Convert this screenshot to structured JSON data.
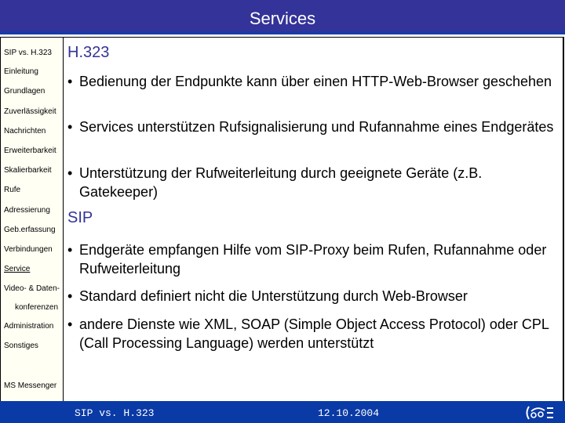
{
  "header": {
    "title": "Services"
  },
  "sidebar": {
    "items": [
      {
        "label": "SIP vs. H.323"
      },
      {
        "label": "Einleitung"
      },
      {
        "label": "Grundlagen"
      },
      {
        "label": "Zuverlässigkeit"
      },
      {
        "label": "Nachrichten"
      },
      {
        "label": "Erweiterbarkeit"
      },
      {
        "label": "Skalierbarkeit"
      },
      {
        "label": "Rufe"
      },
      {
        "label": "Adressierung"
      },
      {
        "label": "Geb.erfassung"
      },
      {
        "label": "Verbindungen"
      },
      {
        "label": "Service",
        "active": true
      },
      {
        "label": "Video- & Daten-"
      },
      {
        "label": "konferenzen"
      },
      {
        "label": "Administration"
      },
      {
        "label": "Sonstiges"
      },
      {
        "label": "MS Messenger"
      }
    ]
  },
  "main": {
    "sections": [
      {
        "heading": "H.323",
        "bullets": [
          "Bedienung der Endpunkte kann über einen HTTP-Web-Browser geschehen",
          "Services unterstützen Rufsignalisierung und Rufannahme eines Endgerätes",
          "Unterstützung der Rufweiterleitung durch geeignete Geräte (z.B. Gatekeeper)"
        ]
      },
      {
        "heading": "SIP",
        "bullets": [
          "Endgeräte empfangen Hilfe vom SIP-Proxy beim Rufen, Rufannahme oder Rufweiterleitung",
          "Standard definiert nicht die Unterstützung durch Web-Browser",
          "andere Dienste wie XML, SOAP (Simple Object Access Protocol) oder CPL (Call Processing Language) werden unterstützt"
        ]
      }
    ],
    "bullet_glyph": "•"
  },
  "footer": {
    "left": "SIP vs. H.323",
    "center": "12.10.2004",
    "logo_icon": "university-logo-icon"
  }
}
